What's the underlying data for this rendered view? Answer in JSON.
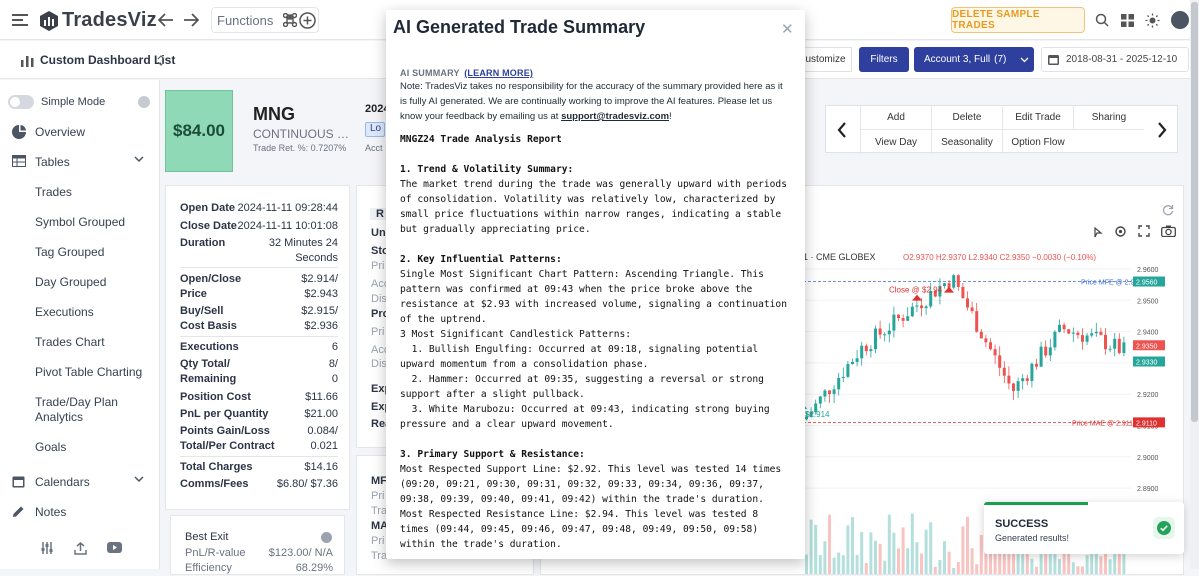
{
  "app": {
    "name": "TradesViz"
  },
  "topbar": {
    "functions_label": "Functions",
    "delete_sample_label": "DELETE SAMPLE TRADES"
  },
  "subbar": {
    "dashboard_title": "Custom Dashboard List",
    "customize_label": "ustomize",
    "filters_label": "Filters",
    "account_label": "Account 3, Full",
    "account_count": "(7)",
    "date_range": "2018-08-31 - 2025-12-10"
  },
  "sidebar": {
    "simple_mode_label": "Simple Mode",
    "items": [
      {
        "label": "Overview"
      },
      {
        "label": "Tables"
      },
      {
        "label": "Trades"
      },
      {
        "label": "Symbol Grouped"
      },
      {
        "label": "Tag Grouped"
      },
      {
        "label": "Day Grouped"
      },
      {
        "label": "Executions"
      },
      {
        "label": "Trades Chart"
      },
      {
        "label": "Pivot Table Charting"
      },
      {
        "label": "Trade/Day Plan Analytics"
      },
      {
        "label": "Goals"
      },
      {
        "label": "Calendars"
      },
      {
        "label": "Notes"
      }
    ]
  },
  "trade_header": {
    "price": "$84.00",
    "symbol": "MNG",
    "description": "CONTINUOUS M...",
    "return_pct": "Trade Ret. %: 0.7207%",
    "side_badge": "Lo",
    "date_partial": "2024",
    "acct_partial": "Acct"
  },
  "trade_details": [
    {
      "key": "Open Date",
      "value": "2024-11-11 09:28:44"
    },
    {
      "key": "Close Date",
      "value": "2024-11-11 10:01:08"
    },
    {
      "key": "Duration",
      "value": "32 Minutes 24 Seconds"
    },
    {
      "key": "Open/Close Price",
      "value": "$2.914/ $2.943"
    },
    {
      "key": "Buy/Sell Cost Basis",
      "value": "$2.915/ $2.936"
    },
    {
      "key": "Executions",
      "value": "6"
    },
    {
      "key": "Qty Total/ Remaining",
      "value": "8/ 0"
    },
    {
      "key": "Position Cost",
      "value": "$11.66"
    },
    {
      "key": "PnL per Quantity",
      "value": "$21.00"
    },
    {
      "key": "Points Gain/Loss",
      "value": "0.084/"
    },
    {
      "key": "Total/Per Contract",
      "value": "0.021"
    },
    {
      "key": "Total Charges",
      "value": "$14.16"
    },
    {
      "key": "Comms/Fees",
      "value": "$6.80/ $7.36"
    }
  ],
  "best_exit": {
    "title": "Best Exit",
    "pnl_label": "PnL/R-value",
    "pnl_value": "$123.00/ N/A",
    "eff_label": "Efficiency",
    "eff_value": "68.29%"
  },
  "middle_partial": [
    "R",
    "Un",
    "Sto",
    "Pri",
    "Acc",
    "Dis",
    "Pro",
    "Pri",
    "Acc",
    "Dis",
    "Exp",
    "Exp",
    "Rea",
    "MF",
    "Pri",
    "Tra",
    "MA",
    "Pri",
    "Tra"
  ],
  "actions": {
    "top": [
      "Add",
      "Delete",
      "Edit Trade",
      "Sharing"
    ],
    "bottom": [
      "View Day",
      "Seasonality",
      "Option Flow"
    ]
  },
  "chart": {
    "header": "1 · CME GLOBEX",
    "ohlc": {
      "o": "O2.9370",
      "h": "H2.9370",
      "l": "L2.9340",
      "c": "C2.9350",
      "chg": "−0.0030 (−0.10%)"
    },
    "close_label": "Close @ $2.94",
    "entry_label": "$2.914",
    "mfe_label": "Price MFE @ 2.956",
    "mfe_value": "2.9560",
    "mae_label": "Price MAE @ 2.91100",
    "mae_value": "2.9110",
    "last_values": [
      "2.9350",
      "2.9330"
    ],
    "price_scale": [
      "2.9600",
      "2.9500",
      "2.9400",
      "2.9300",
      "2.9200",
      "2.9100",
      "2.9000",
      "2.8900"
    ],
    "colors": {
      "up": "#26a69a",
      "down": "#ef5350",
      "mfe": "#3f6ad8",
      "mae": "#e03131"
    }
  },
  "modal": {
    "title": "AI Generated Trade Summary",
    "ai_label": "AI SUMMARY",
    "learn_more": "(LEARN MORE)",
    "note": "Note: TradesViz takes no responsibility for the accuracy of the summary provided here as it is fully AI generated. We are continually working to improve the AI features. Please let us know your feedback by emailing us at",
    "email": "support@tradesviz.com",
    "note_end": "!",
    "report_title": "MNGZ24 Trade Analysis Report",
    "s1_title": "1. Trend & Volatility Summary:",
    "s1_body": "The market trend during the trade was generally upward with periods of consolidation. Volatility was relatively low, characterized by small price fluctuations within narrow ranges, indicating a stable but gradually appreciating price.",
    "s2_title": "2. Key Influential Patterns:",
    "s2_body": "Single Most Significant Chart Pattern: Ascending Triangle. This pattern was confirmed at 09:43 when the price broke above the resistance at $2.93 with increased volume, signaling a continuation of the uptrend.\n3 Most Significant Candlestick Patterns:\n  1. Bullish Engulfing: Occurred at 09:18, signaling potential upward momentum from a consolidation phase.\n  2. Hammer: Occurred at 09:35, suggesting a reversal or strong support after a slight pullback.\n  3. White Marubozu: Occurred at 09:43, indicating strong buying pressure and a clear upward movement.",
    "s3_title": "3. Primary Support & Resistance:",
    "s3_body": "Most Respected Support Line: $2.92. This level was tested 14 times (09:20, 09:21, 09:30, 09:31, 09:32, 09:33, 09:34, 09:36, 09:37, 09:38, 09:39, 09:40, 09:41, 09:42) within the trade's duration.\nMost Respected Resistance Line: $2.94. This level was tested 8 times (09:44, 09:45, 09:46, 09:47, 09:48, 09:49, 09:50, 09:58) within the trade's duration."
  },
  "toast": {
    "title": "SUCCESS",
    "message": "Generated results!",
    "progress": 0.52
  }
}
